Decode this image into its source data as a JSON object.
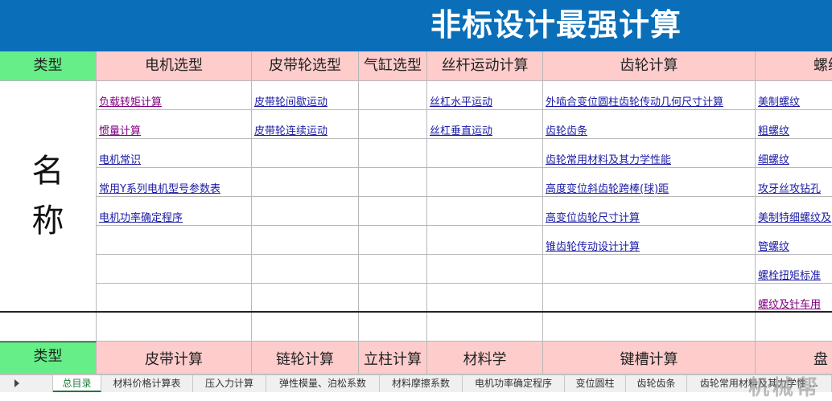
{
  "banner": {
    "title": "非标设计最强计算"
  },
  "section1": {
    "type_label": "类型",
    "headers": [
      "电机选型",
      "皮带轮选型",
      "气缸选型",
      "丝杆运动计算",
      "齿轮计算",
      "螺纹"
    ],
    "name_label": [
      "名",
      "称"
    ],
    "col_motor": [
      "负载转矩计算",
      "惯量计算",
      "电机常识",
      "常用Y系列电机型号参数表",
      "电机功率确定程序"
    ],
    "col_belt": [
      "皮带轮间歇运动",
      "皮带轮连续运动"
    ],
    "col_screw": [
      "丝杠水平运动",
      "丝杠垂直运动"
    ],
    "col_gear": [
      "外啮合变位圆柱齿轮传动几何尺寸计算",
      "齿轮齿条",
      "齿轮常用材料及其力学性能",
      "高度变位斜齿轮跨棒(球)距",
      "高变位齿轮尺寸计算",
      "锥齿轮传动设计计算"
    ],
    "col_thread": [
      "美制螺纹",
      "粗螺纹",
      "细螺纹",
      "攻牙丝攻钻孔",
      "美制特细螺纹及",
      "管螺纹",
      "螺栓扭矩标准",
      "螺纹及针车用"
    ]
  },
  "section2": {
    "type_label": "类型",
    "headers": [
      "皮带计算",
      "链轮计算",
      "立柱计算",
      "材料学",
      "键槽计算",
      "盘"
    ]
  },
  "tabs": [
    {
      "label": "总目录",
      "active": true
    },
    {
      "label": "材料价格计算表",
      "active": false
    },
    {
      "label": "压入力计算",
      "active": false
    },
    {
      "label": "弹性模量、泊松系数",
      "active": false
    },
    {
      "label": "材料摩擦系数",
      "active": false
    },
    {
      "label": "电机功率确定程序",
      "active": false
    },
    {
      "label": "变位圆柱",
      "active": false
    },
    {
      "label": "齿轮齿条",
      "active": false
    },
    {
      "label": "齿轮常用材料及其力学性 ...",
      "active": false
    }
  ],
  "watermark": "机械帮",
  "colors": {
    "banner": "#0a6fb8",
    "header_pink": "#ffcccc",
    "type_green": "#66ee88",
    "link": "#1a1aa6",
    "visited_link": "#800080"
  }
}
